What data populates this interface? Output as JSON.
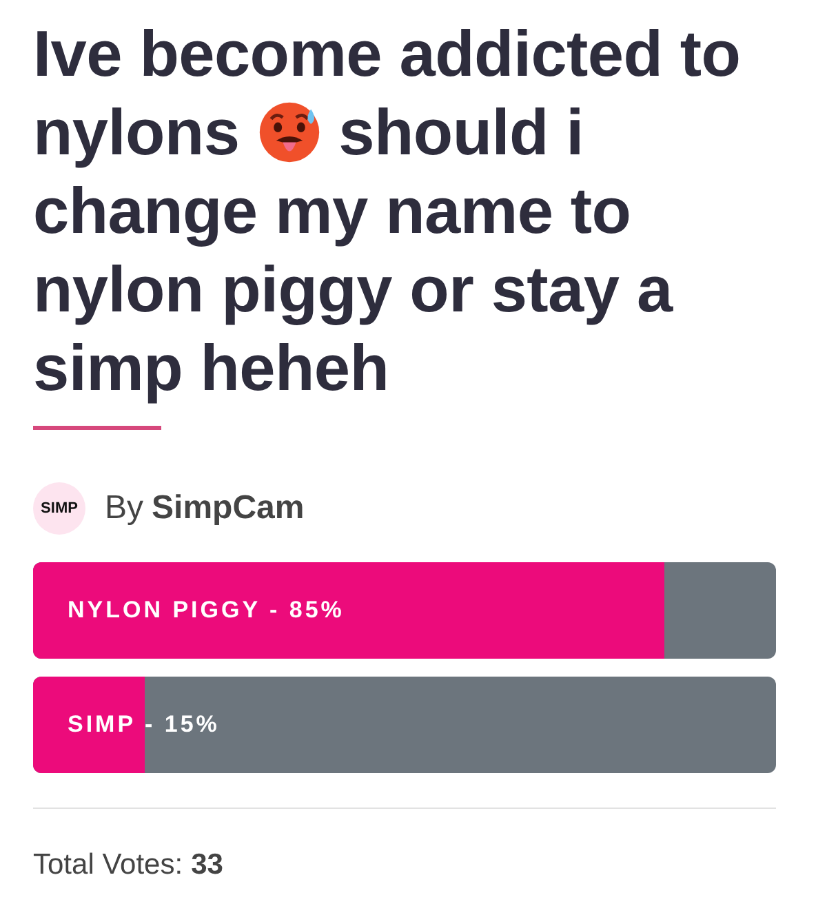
{
  "question": {
    "first_line": "Ive become addicted to",
    "before_emoji": "nylons",
    "after_emoji": "should i",
    "more_lines": [
      "change my name to",
      "nylon piggy or stay a",
      "simp heheh"
    ]
  },
  "author": {
    "avatar_text": "SIMP",
    "by": "By",
    "name": "SimpCam"
  },
  "options": [
    {
      "label": "NYLON PIGGY - 85%",
      "level": 0.85
    },
    {
      "label": "SIMP - 15%",
      "level": 0.15
    }
  ],
  "total": {
    "label": "Total Votes:",
    "count": "33"
  }
}
